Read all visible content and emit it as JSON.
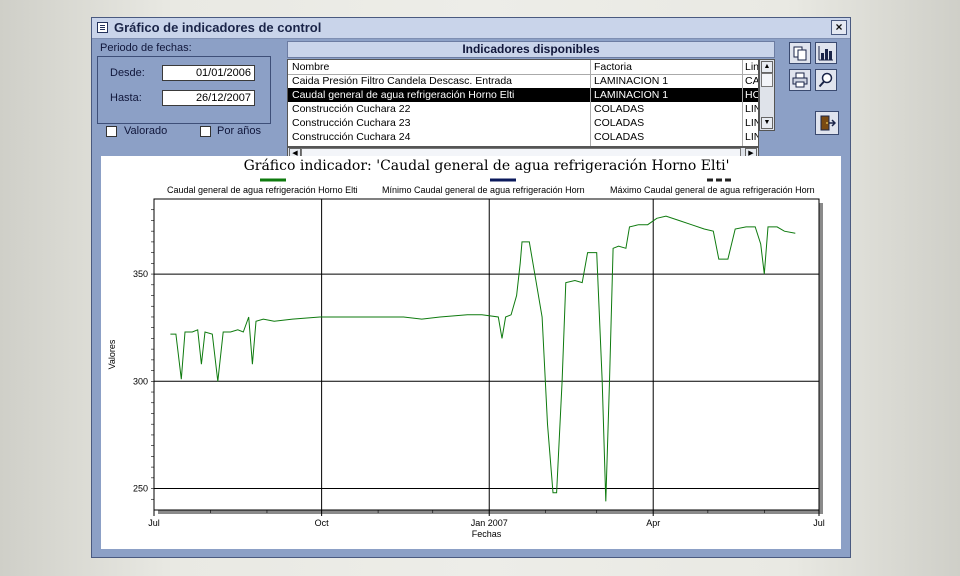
{
  "window": {
    "title": "Gráfico de indicadores de control",
    "close_glyph": "×"
  },
  "filters": {
    "period_label": "Periodo de fechas:",
    "from_label": "Desde:",
    "from_value": "01/01/2006",
    "to_label": "Hasta:",
    "to_value": "26/12/2007",
    "valorado_label": "Valorado",
    "por_anos_label": "Por años"
  },
  "indicators": {
    "title": "Indicadores disponibles",
    "columns": [
      "Nombre",
      "Factoria",
      "Lin"
    ],
    "rows": [
      {
        "name": "Caida Presión Filtro Candela Descasc. Entrada",
        "factory": "LAMINACION 1",
        "line": "CA"
      },
      {
        "name": "Caudal general de agua refrigeración Horno Elti",
        "factory": "LAMINACION 1",
        "line": "HO"
      },
      {
        "name": "Construcción Cuchara 22",
        "factory": "COLADAS",
        "line": "LIN"
      },
      {
        "name": "Construcción Cuchara 23",
        "factory": "COLADAS",
        "line": "LIN"
      },
      {
        "name": "Construcción Cuchara 24",
        "factory": "COLADAS",
        "line": "LIN"
      }
    ],
    "selected_index": 1
  },
  "toolbar": {
    "copy_icon": "copy-icon",
    "chart_icon": "bar-chart-icon",
    "print_icon": "printer-icon",
    "zoom_icon": "magnifier-icon",
    "exit_icon": "exit-door-icon"
  },
  "colors": {
    "series": "#0e7a0e",
    "min": "#0b1a5c",
    "max": "#222222"
  },
  "chart_data": {
    "type": "line",
    "title": "Gráfico indicador: 'Caudal general de agua refrigeración Horno Elti'",
    "xlabel": "Fechas",
    "ylabel": "Valores",
    "x_ticks": [
      "Jul",
      "Oct",
      "Jan 2007",
      "Apr",
      "Jul"
    ],
    "x_range": [
      "2006-07-01",
      "2007-07-01"
    ],
    "y_ticks": [
      250,
      300,
      350
    ],
    "ylim": [
      240,
      385
    ],
    "grid": true,
    "legend_position": "top",
    "series": [
      {
        "name": "Caudal general de agua refrigeración Horno Elti",
        "line_style": "solid",
        "points": [
          [
            "2006-07-10",
            322
          ],
          [
            "2006-07-13",
            322
          ],
          [
            "2006-07-16",
            301
          ],
          [
            "2006-07-18",
            323
          ],
          [
            "2006-07-22",
            323
          ],
          [
            "2006-07-25",
            324
          ],
          [
            "2006-07-27",
            308
          ],
          [
            "2006-07-29",
            323
          ],
          [
            "2006-08-02",
            322
          ],
          [
            "2006-08-05",
            300
          ],
          [
            "2006-08-08",
            323
          ],
          [
            "2006-08-12",
            323
          ],
          [
            "2006-08-16",
            324
          ],
          [
            "2006-08-19",
            323
          ],
          [
            "2006-08-22",
            330
          ],
          [
            "2006-08-24",
            308
          ],
          [
            "2006-08-26",
            328
          ],
          [
            "2006-08-30",
            329
          ],
          [
            "2006-09-05",
            328
          ],
          [
            "2006-09-15",
            329
          ],
          [
            "2006-09-30",
            330
          ],
          [
            "2006-10-15",
            330
          ],
          [
            "2006-11-01",
            330
          ],
          [
            "2006-11-15",
            330
          ],
          [
            "2006-11-25",
            329
          ],
          [
            "2006-12-05",
            330
          ],
          [
            "2006-12-20",
            331
          ],
          [
            "2006-12-28",
            331
          ],
          [
            "2007-01-06",
            330
          ],
          [
            "2007-01-08",
            320
          ],
          [
            "2007-01-10",
            330
          ],
          [
            "2007-01-13",
            331
          ],
          [
            "2007-01-16",
            340
          ],
          [
            "2007-01-18",
            355
          ],
          [
            "2007-01-19",
            365
          ],
          [
            "2007-01-23",
            365
          ],
          [
            "2007-01-26",
            350
          ],
          [
            "2007-01-30",
            330
          ],
          [
            "2007-02-02",
            280
          ],
          [
            "2007-02-05",
            248
          ],
          [
            "2007-02-07",
            248
          ],
          [
            "2007-02-10",
            300
          ],
          [
            "2007-02-12",
            346
          ],
          [
            "2007-02-17",
            347
          ],
          [
            "2007-02-21",
            346
          ],
          [
            "2007-02-24",
            360
          ],
          [
            "2007-03-01",
            360
          ],
          [
            "2007-03-04",
            300
          ],
          [
            "2007-03-06",
            244
          ],
          [
            "2007-03-08",
            300
          ],
          [
            "2007-03-10",
            362
          ],
          [
            "2007-03-13",
            363
          ],
          [
            "2007-03-17",
            362
          ],
          [
            "2007-03-19",
            372
          ],
          [
            "2007-03-24",
            373
          ],
          [
            "2007-03-29",
            373
          ],
          [
            "2007-04-03",
            376
          ],
          [
            "2007-04-08",
            377
          ],
          [
            "2007-04-15",
            375
          ],
          [
            "2007-04-22",
            373
          ],
          [
            "2007-04-29",
            371
          ],
          [
            "2007-05-04",
            370
          ],
          [
            "2007-05-07",
            357
          ],
          [
            "2007-05-12",
            357
          ],
          [
            "2007-05-16",
            371
          ],
          [
            "2007-05-22",
            372
          ],
          [
            "2007-05-27",
            372
          ],
          [
            "2007-05-30",
            364
          ],
          [
            "2007-06-01",
            350
          ],
          [
            "2007-06-03",
            372
          ],
          [
            "2007-06-08",
            372
          ],
          [
            "2007-06-12",
            370
          ],
          [
            "2007-06-18",
            369
          ]
        ]
      },
      {
        "name": "Mínimo Caudal general de agua refrigeración Horn",
        "line_style": "solid",
        "points": []
      },
      {
        "name": "Máximo Caudal general de agua refrigeración Horn",
        "line_style": "dashed",
        "points": []
      }
    ]
  }
}
